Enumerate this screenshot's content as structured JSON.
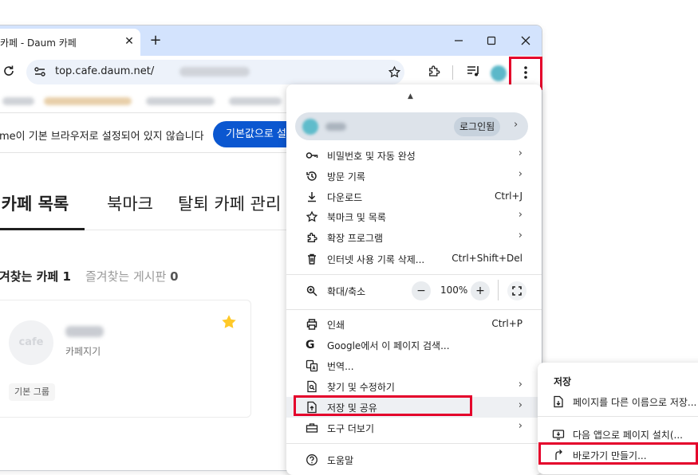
{
  "browser": {
    "tab_title": "카페 - Daum 카페",
    "tab_close": "✕",
    "new_tab": "+",
    "url": "top.cafe.daum.net/",
    "accent": "#0b57d0",
    "highlight_color": "#e4002b"
  },
  "infobar": {
    "text": "me이 기본 브라우저로 설정되어 있지 않습니다",
    "button": "기본값으로 설정"
  },
  "page": {
    "tabs": [
      "내 카페 목록",
      "북마크",
      "탈퇴 카페 관리"
    ],
    "fav_label": "겨찾는 카페 1",
    "board_label": "즐겨찾는 게시판",
    "board_count": "0",
    "card": {
      "logo": "cafe",
      "sub": "카페지기",
      "group": "기본 그룹"
    }
  },
  "menu": {
    "login": "로그인됨",
    "items": [
      {
        "label": "비밀번호 및 자동 완성",
        "shortcut": "",
        "arrow": "›"
      },
      {
        "label": "방문 기록",
        "shortcut": "",
        "arrow": "›"
      },
      {
        "label": "다운로드",
        "shortcut": "Ctrl+J",
        "arrow": ""
      },
      {
        "label": "북마크 및 목록",
        "shortcut": "",
        "arrow": "›"
      },
      {
        "label": "확장 프로그램",
        "shortcut": "",
        "arrow": "›"
      },
      {
        "label": "인터넷 사용 기록 삭제...",
        "shortcut": "Ctrl+Shift+Del",
        "arrow": ""
      }
    ],
    "zoom": {
      "label": "확대/축소",
      "minus": "−",
      "value": "100%",
      "plus": "+"
    },
    "items2": [
      {
        "label": "인쇄",
        "shortcut": "Ctrl+P",
        "arrow": ""
      },
      {
        "label": "Google에서 이 페이지 검색...",
        "shortcut": "",
        "arrow": ""
      },
      {
        "label": "번역...",
        "shortcut": "",
        "arrow": ""
      },
      {
        "label": "찾기 및 수정하기",
        "shortcut": "",
        "arrow": "›"
      },
      {
        "label": "저장 및 공유",
        "shortcut": "",
        "arrow": "›"
      },
      {
        "label": "도구 더보기",
        "shortcut": "",
        "arrow": "›"
      }
    ],
    "help": "도움말"
  },
  "submenu": {
    "title": "저장",
    "items": [
      "페이지를 다른 이름으로 저장...",
      "다음 앱으로 페이지 설치(...",
      "바로가기 만들기..."
    ]
  }
}
